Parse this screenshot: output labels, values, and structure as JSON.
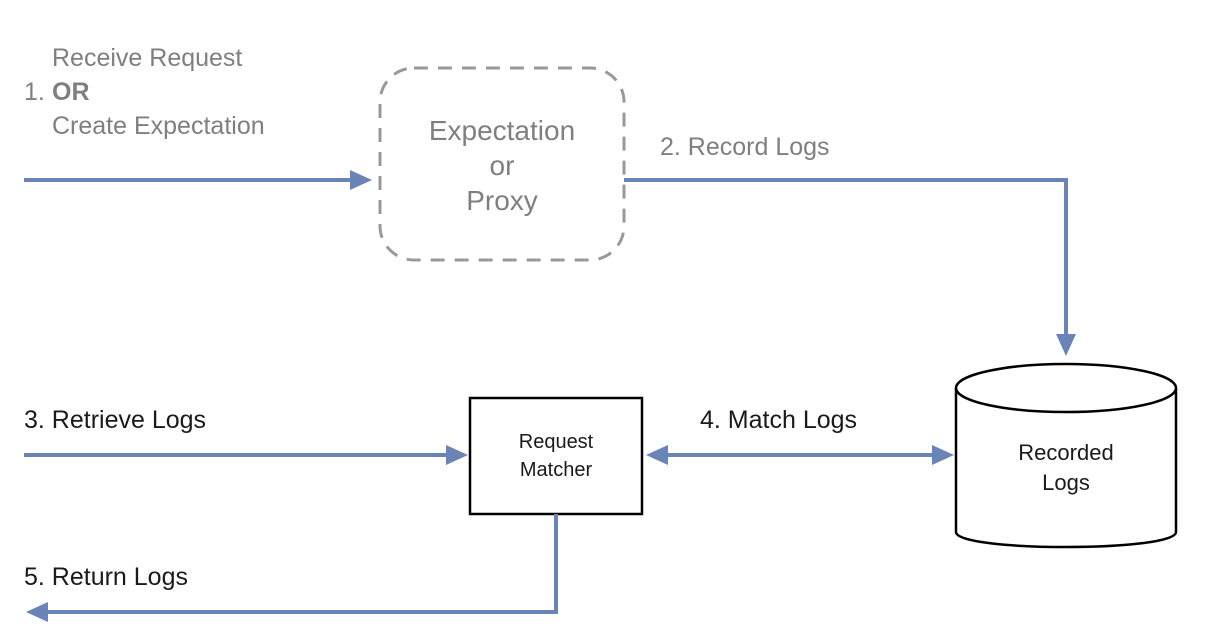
{
  "step1": {
    "number": "1.",
    "line1": "Receive Request",
    "or": "OR",
    "line2": "Create Expectation"
  },
  "expectation_box": {
    "line1": "Expectation",
    "line2": "or",
    "line3": "Proxy"
  },
  "step2": "2. Record Logs",
  "step3": "3. Retrieve Logs",
  "step4": "4. Match Logs",
  "step5": "5. Return Logs",
  "request_matcher": {
    "line1": "Request",
    "line2": "Matcher"
  },
  "recorded_logs": {
    "line1": "Recorded",
    "line2": "Logs"
  }
}
